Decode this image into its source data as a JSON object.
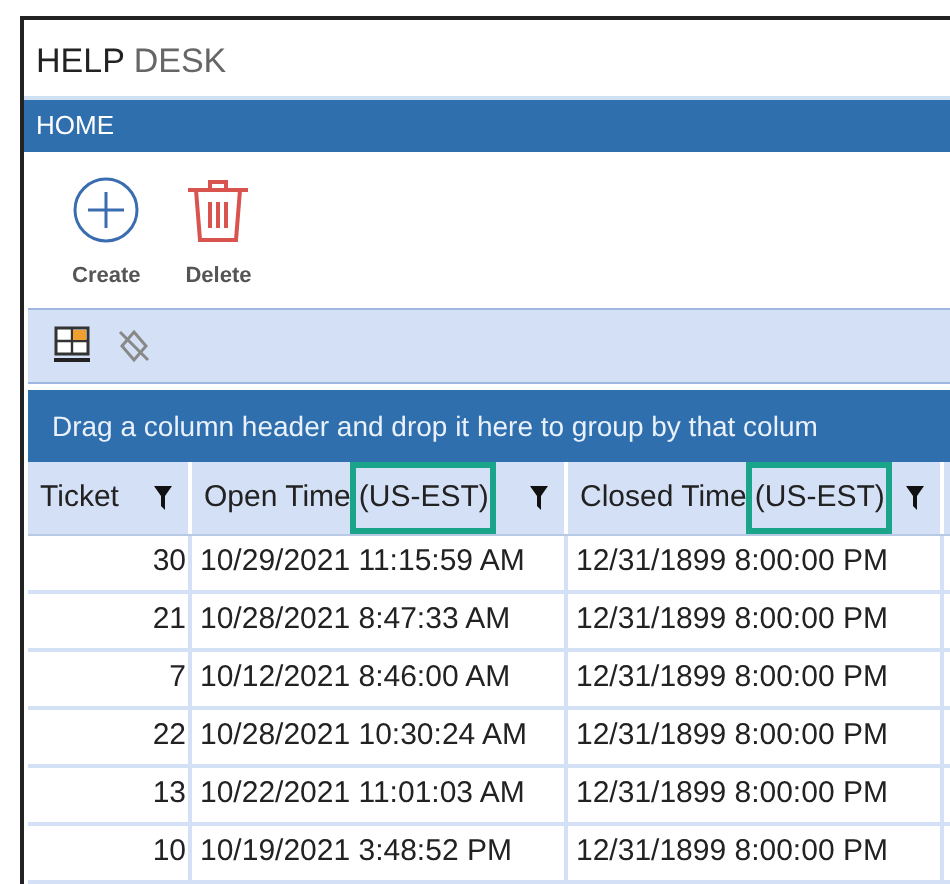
{
  "window": {
    "title_bold": "HELP",
    "title_rest": "DESK"
  },
  "ribbon_tab": {
    "label": "HOME"
  },
  "ribbon_buttons": [
    {
      "kind": "create",
      "label": "Create"
    },
    {
      "kind": "delete",
      "label": "Delete"
    }
  ],
  "group_panel": {
    "text": "Drag a column header and drop it here to group by that colum"
  },
  "table": {
    "columns": [
      {
        "label": "Ticket"
      },
      {
        "label": "Open Time",
        "note": "(US-EST)"
      },
      {
        "label": "Closed Time",
        "note": "(US-EST)"
      }
    ],
    "rows": [
      [
        "30",
        "10/29/2021 11:15:59 AM",
        "12/31/1899 8:00:00 PM"
      ],
      [
        "21",
        "10/28/2021 8:47:33 AM",
        "12/31/1899 8:00:00 PM"
      ],
      [
        "7",
        "10/12/2021 8:46:00 AM",
        "12/31/1899 8:00:00 PM"
      ],
      [
        "22",
        "10/28/2021 10:30:24 AM",
        "12/31/1899 8:00:00 PM"
      ],
      [
        "13",
        "10/22/2021 11:01:03 AM",
        "12/31/1899 8:00:00 PM"
      ],
      [
        "10",
        "10/19/2021 3:48:52 PM",
        "12/31/1899 8:00:00 PM"
      ]
    ]
  }
}
